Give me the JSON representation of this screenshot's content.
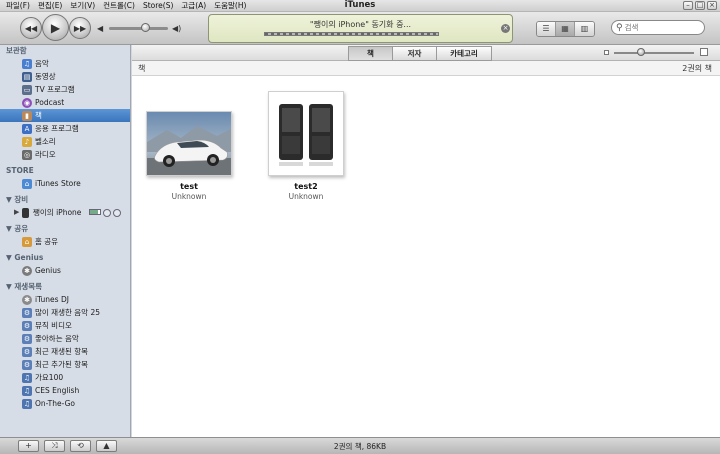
{
  "window": {
    "title": "iTunes"
  },
  "menu": [
    "파일(F)",
    "편집(E)",
    "보기(V)",
    "컨트롤(C)",
    "Store(S)",
    "고급(A)",
    "도움말(H)"
  ],
  "lcd": {
    "status": "\"쨍이의 iPhone\" 동기화 중..."
  },
  "search": {
    "placeholder": "검색"
  },
  "sidebar": {
    "library": {
      "header": "보관함",
      "items": [
        "음악",
        "동영상",
        "TV 프로그램",
        "Podcast",
        "책",
        "응용 프로그램",
        "벨소리",
        "라디오"
      ]
    },
    "store": {
      "header": "STORE",
      "items": [
        "iTunes Store"
      ]
    },
    "devices": {
      "header": "장비",
      "items": [
        "쨍이의 iPhone"
      ]
    },
    "shared": {
      "header": "공유",
      "items": [
        "홈 공유"
      ]
    },
    "genius": {
      "header": "Genius",
      "items": [
        "Genius"
      ]
    },
    "playlists": {
      "header": "재생목록",
      "items": [
        "iTunes DJ",
        "많이 재생한 음악 25",
        "뮤직 비디오",
        "좋아하는 음악",
        "최근 재생된 항목",
        "최근 추가된 항목",
        "가요100",
        "CES English",
        "On-The-Go"
      ]
    }
  },
  "filter": {
    "tabs": [
      "책",
      "저자",
      "카테고리"
    ],
    "active": "책"
  },
  "group": {
    "title": "책",
    "count": "2권의 책"
  },
  "books": [
    {
      "title": "test",
      "artist": "Unknown"
    },
    {
      "title": "test2",
      "artist": "Unknown"
    }
  ],
  "status": {
    "text": "2권의 책, 86KB"
  },
  "colors": {
    "selection": "#3a74bc",
    "sidebar_bg": "#d7dde6",
    "lcd_bg": "#e6ecce"
  }
}
